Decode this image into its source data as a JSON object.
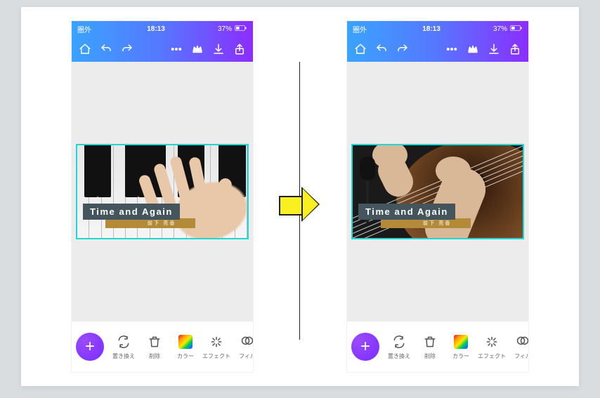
{
  "status": {
    "carrier": "圏外",
    "time": "18:13",
    "battery": "37%"
  },
  "canvas": {
    "title": "Time and Again",
    "subtitle": "前下 亮香"
  },
  "bottom_tools": {
    "replace": "置き換え",
    "delete": "削除",
    "color": "カラー",
    "effect": "エフェクト",
    "filter": "フィル"
  }
}
